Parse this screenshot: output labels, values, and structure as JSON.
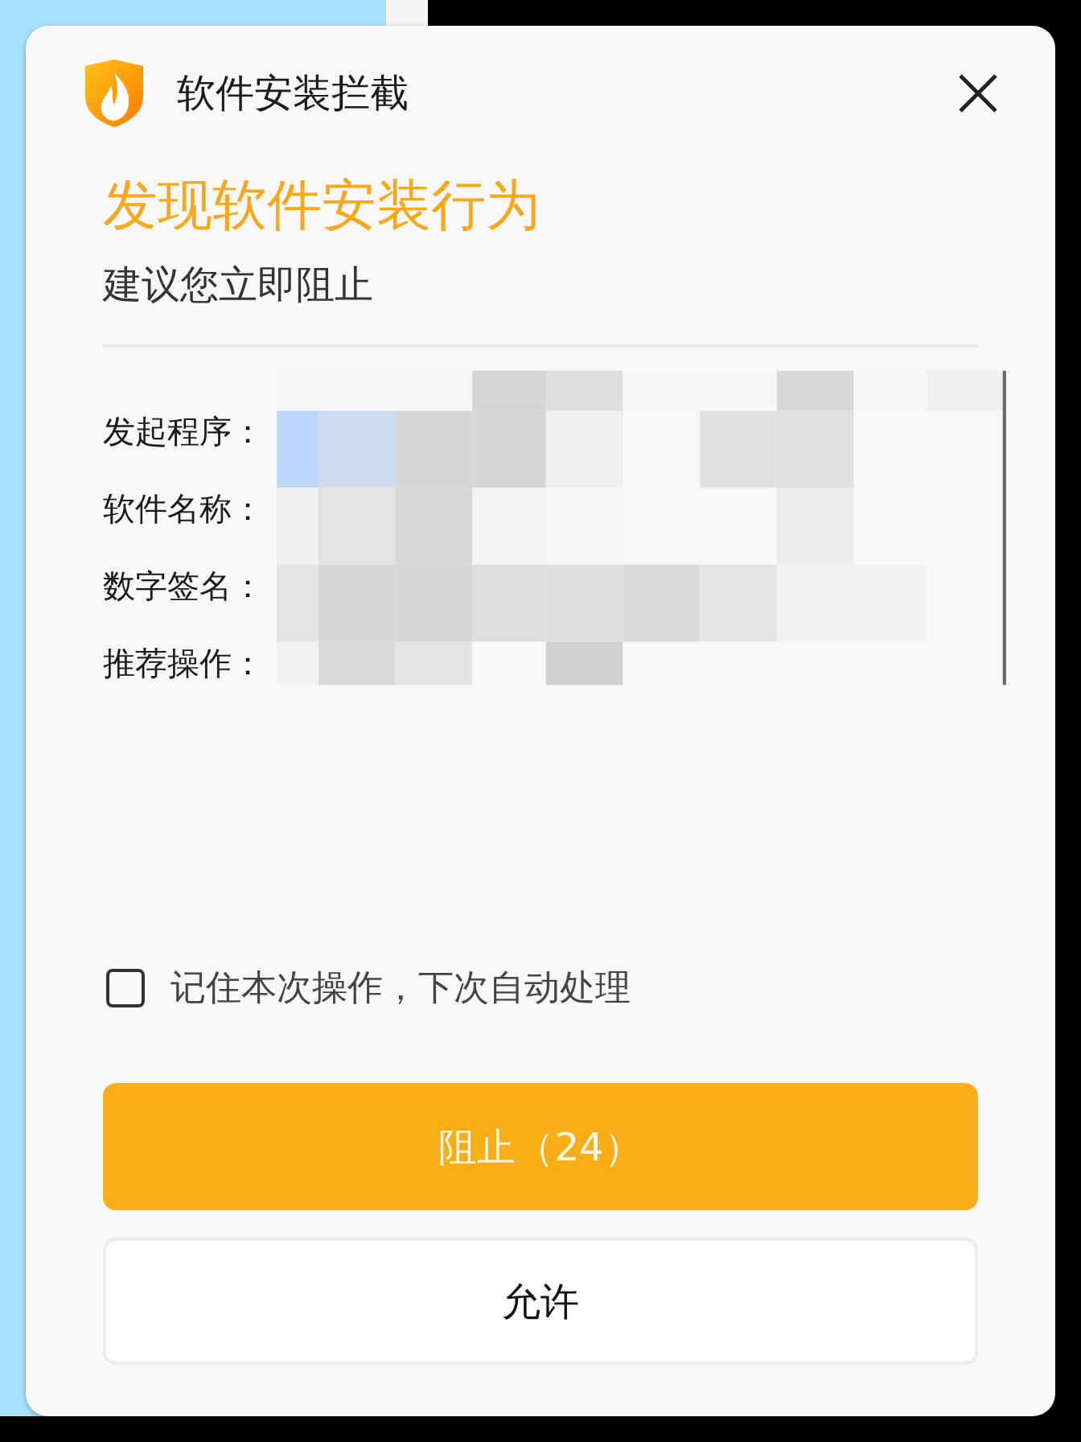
{
  "window": {
    "title": "软件安装拦截"
  },
  "headline": "发现软件安装行为",
  "subtitle": "建议您立即阻止",
  "info_rows": [
    {
      "label": "发起程序："
    },
    {
      "label": "软件名称："
    },
    {
      "label": "数字签名："
    },
    {
      "label": "推荐操作："
    }
  ],
  "remember": {
    "label": "记住本次操作，下次自动处理",
    "checked": false
  },
  "buttons": [
    {
      "label": "阻止（24）",
      "kind": "primary"
    },
    {
      "label": "允许",
      "kind": "secondary"
    }
  ]
}
